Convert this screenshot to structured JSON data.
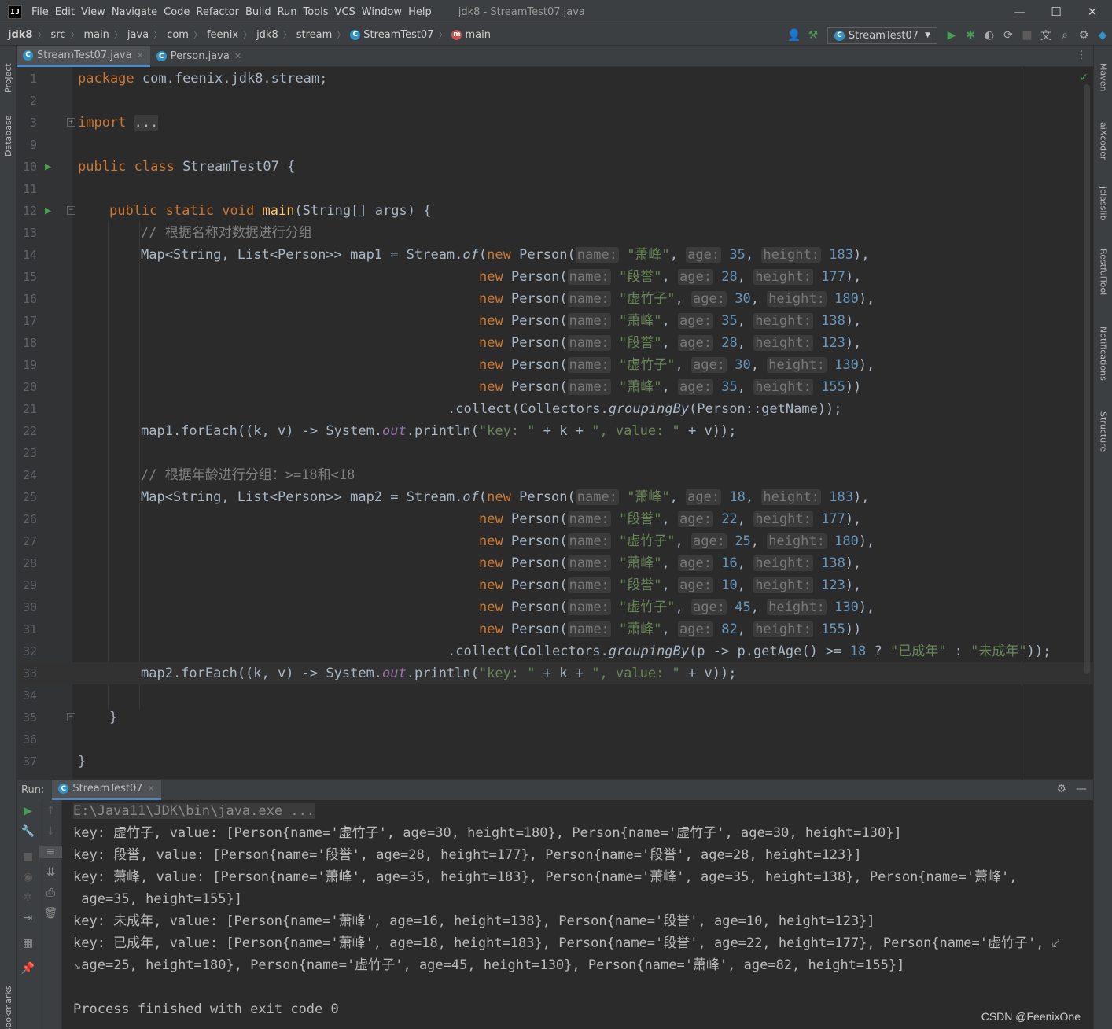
{
  "menubar": {
    "app_icon": "IJ",
    "items": [
      "File",
      "Edit",
      "View",
      "Navigate",
      "Code",
      "Refactor",
      "Build",
      "Run",
      "Tools",
      "VCS",
      "Window",
      "Help"
    ],
    "title": "jdk8 - StreamTest07.java",
    "minimize": "—",
    "maximize": "☐",
    "close": "✕"
  },
  "breadcrumb": {
    "items": [
      "jdk8",
      "src",
      "main",
      "java",
      "com",
      "feenix",
      "jdk8",
      "stream",
      "StreamTest07",
      "main"
    ]
  },
  "toolbar": {
    "run_config": "StreamTest07"
  },
  "left_strip": {
    "project": "Project",
    "database": "Database",
    "bookmarks": "Bookmarks"
  },
  "right_strip": {
    "maven": "Maven",
    "aixcoder": "aiXcoder",
    "jclasslib": "jclasslib",
    "restfultool": "RestfulTool",
    "notifications": "Notifications",
    "structure": "Structure"
  },
  "tabs": [
    {
      "label": "StreamTest07.java",
      "active": true
    },
    {
      "label": "Person.java",
      "active": false
    }
  ],
  "editor": {
    "line_numbers": [
      "1",
      "2",
      "3",
      "9",
      "10",
      "11",
      "12",
      "13",
      "14",
      "15",
      "16",
      "17",
      "18",
      "19",
      "20",
      "21",
      "22",
      "23",
      "24",
      "25",
      "26",
      "27",
      "28",
      "29",
      "30",
      "31",
      "32",
      "33",
      "34",
      "35",
      "36",
      "37"
    ],
    "current_line": "33",
    "accent": "#4a88c7"
  },
  "code": {
    "package_kw": "package",
    "package_name": " com.feenix.jdk8.stream",
    "import_kw": "import",
    "import_folded": "...",
    "class_decl": "public class",
    "class_name": " StreamTest07 {",
    "main_mods": "public static void",
    "main_name": "main",
    "main_params": "(String[] args) {",
    "comment1": "// 根据名称对数据进行分组",
    "map1_decl": "Map<String, List<Person>> map1 = Stream.",
    "map2_decl": "Map<String, List<Person>> map2 = Stream.",
    "of": "of",
    "comment2": "// 根据年龄进行分组：>=18和<18",
    "collect1_a": ".collect(Collectors.",
    "grouping": "groupingBy",
    "collect1_b": "(Person::getName));",
    "collect2_b": "(p -> p.getAge() >= ",
    "age18": "18",
    "adult": "\"已成年\"",
    "minor": "\"未成年\"",
    "foreach1": "map1.forEach((k, v) -> System.",
    "foreach2": "map2.forEach((k, v) -> System.",
    "out": "out",
    "println": ".println(",
    "key_str": "\"key: \"",
    "concat_k": " + k + ",
    "value_str": "\", value: \"",
    "concat_v": " + v));",
    "new_kw": "new",
    "person_ctor": " Person(",
    "hint_name": "name:",
    "hint_age": "age:",
    "hint_height": "height:",
    "close_brace_inner": "}",
    "close_brace_outer": "}",
    "persons1": [
      {
        "name": "\"萧峰\"",
        "age": "35",
        "height": "183",
        "end": "),"
      },
      {
        "name": "\"段誉\"",
        "age": "28",
        "height": "177",
        "end": "),"
      },
      {
        "name": "\"虚竹子\"",
        "age": "30",
        "height": "180",
        "end": "),"
      },
      {
        "name": "\"萧峰\"",
        "age": "35",
        "height": "138",
        "end": "),"
      },
      {
        "name": "\"段誉\"",
        "age": "28",
        "height": "123",
        "end": "),"
      },
      {
        "name": "\"虚竹子\"",
        "age": "30",
        "height": "130",
        "end": "),"
      },
      {
        "name": "\"萧峰\"",
        "age": "35",
        "height": "155",
        "end": "))"
      }
    ],
    "persons2": [
      {
        "name": "\"萧峰\"",
        "age": "18",
        "height": "183",
        "end": "),"
      },
      {
        "name": "\"段誉\"",
        "age": "22",
        "height": "177",
        "end": "),"
      },
      {
        "name": "\"虚竹子\"",
        "age": "25",
        "height": "180",
        "end": "),"
      },
      {
        "name": "\"萧峰\"",
        "age": "16",
        "height": "138",
        "end": "),"
      },
      {
        "name": "\"段誉\"",
        "age": "10",
        "height": "123",
        "end": "),"
      },
      {
        "name": "\"虚竹子\"",
        "age": "45",
        "height": "130",
        "end": "),"
      },
      {
        "name": "\"萧峰\"",
        "age": "82",
        "height": "155",
        "end": "))"
      }
    ]
  },
  "run_panel": {
    "label": "Run:",
    "tab": "StreamTest07",
    "command": "E:\\Java11\\JDK\\bin\\java.exe ...",
    "output": [
      "key: 虚竹子, value: [Person{name='虚竹子', age=30, height=180}, Person{name='虚竹子', age=30, height=130}]",
      "key: 段誉, value: [Person{name='段誉', age=28, height=177}, Person{name='段誉', age=28, height=123}]",
      "key: 萧峰, value: [Person{name='萧峰', age=35, height=183}, Person{name='萧峰', age=35, height=138}, Person{name='萧峰',",
      " age=35, height=155}]",
      "key: 未成年, value: [Person{name='萧峰', age=16, height=138}, Person{name='段誉', age=10, height=123}]",
      "key: 已成年, value: [Person{name='萧峰', age=18, height=183}, Person{name='段誉', age=22, height=177}, Person{name='虚竹子', ",
      "age=25, height=180}, Person{name='虚竹子', age=45, height=130}, Person{name='萧峰', age=82, height=155}]"
    ],
    "exit": "Process finished with exit code 0"
  },
  "watermark": "CSDN @FeenixOne"
}
